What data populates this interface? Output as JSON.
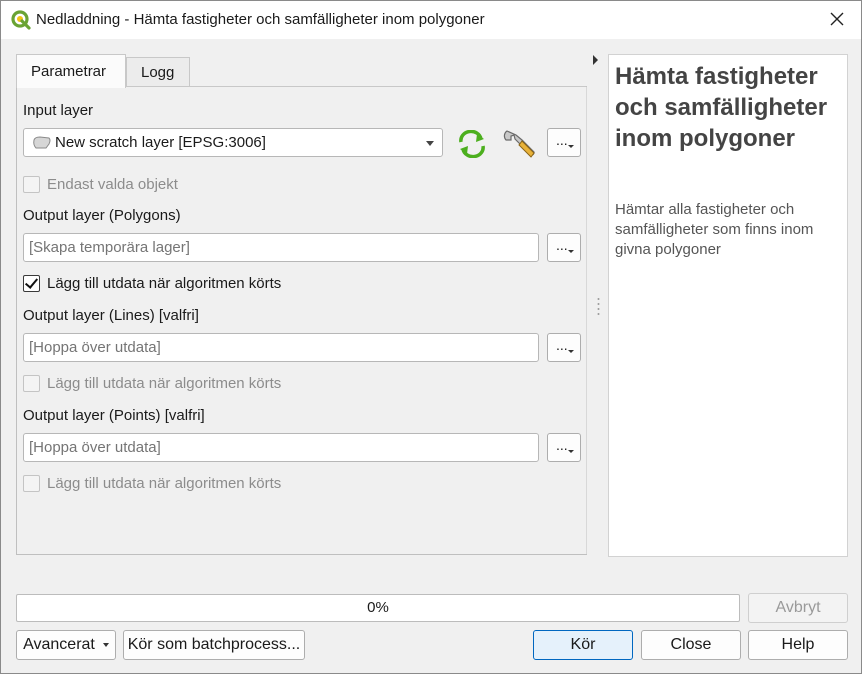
{
  "window": {
    "title": "Nedladdning - Hämta fastigheter och samfälligheter inom polygoner"
  },
  "tabs": [
    {
      "label": "Parametrar",
      "active": true
    },
    {
      "label": "Logg",
      "active": false
    }
  ],
  "params": {
    "input_layer": {
      "label": "Input layer",
      "value": "New scratch layer [EPSG:3006]",
      "more_label": "..."
    },
    "selected_only": {
      "label": "Endast valda objekt",
      "checked": false,
      "enabled": false
    },
    "output_polygons": {
      "label": "Output layer (Polygons)",
      "placeholder": "[Skapa temporära lager]",
      "more_label": "...",
      "add_output": {
        "label": "Lägg till utdata när algoritmen körts",
        "checked": true,
        "enabled": true
      }
    },
    "output_lines": {
      "label": "Output layer (Lines) [valfri]",
      "placeholder": "[Hoppa över utdata]",
      "more_label": "...",
      "add_output": {
        "label": "Lägg till utdata när algoritmen körts",
        "checked": false,
        "enabled": false
      }
    },
    "output_points": {
      "label": "Output layer (Points) [valfri]",
      "placeholder": "[Hoppa över utdata]",
      "more_label": "...",
      "add_output": {
        "label": "Lägg till utdata när algoritmen körts",
        "checked": false,
        "enabled": false
      }
    }
  },
  "help": {
    "title": "Hämta fastigheter och samfälligheter inom polygoner",
    "description": "Hämtar alla fastigheter och samfälligheter som finns inom givna polygoner"
  },
  "progress": {
    "value": 0,
    "text": "0%"
  },
  "buttons": {
    "cancel": "Avbryt",
    "advanced": "Avancerat",
    "batch": "Kör som batchprocess...",
    "run": "Kör",
    "close": "Close",
    "help": "Help"
  },
  "colors": {
    "accent": "#0067c0",
    "iterate_icon": "#4caf1e",
    "progress_fill": "#06b025"
  },
  "icons": {
    "app": "qgis-logo-icon",
    "close": "close-icon",
    "layer": "polygon-layer-icon",
    "iterate": "iterate-icon",
    "settings": "wrench-icon"
  }
}
